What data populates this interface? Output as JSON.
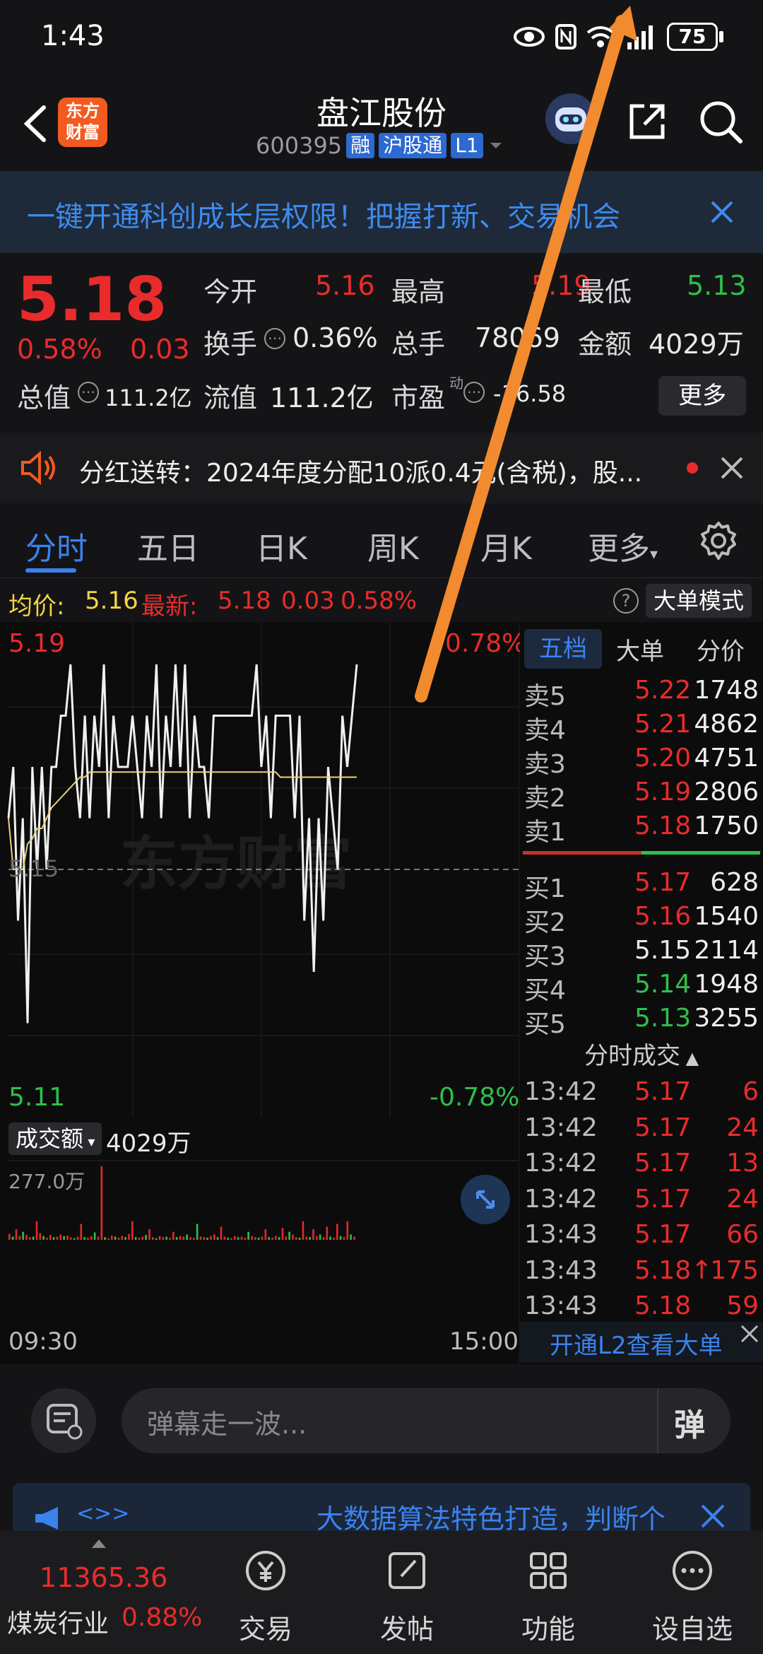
{
  "status": {
    "time": "1:43",
    "battery": "75"
  },
  "header": {
    "logo_text_1": "东方",
    "logo_text_2": "财富",
    "stock_name": "盘江股份",
    "stock_code": "600395",
    "tag_margin": "融",
    "tag_connect": "沪股通",
    "tag_level": "L1"
  },
  "banner": {
    "text": "一键开通科创成长层权限！把握打新、交易机会"
  },
  "quote": {
    "price": "5.18",
    "change_pct": "0.58%",
    "change_abs": "0.03",
    "open_label": "今开",
    "open_value": "5.16",
    "high_label": "最高",
    "high_value": "5.19",
    "low_label": "最低",
    "low_value": "5.13",
    "turnover_label": "换手",
    "turnover_value": "0.36%",
    "volume_label": "总手",
    "volume_value": "78069",
    "amount_label": "金额",
    "amount_value": "4029万",
    "mktcap_label": "总值",
    "mktcap_value": "111.2亿",
    "float_label": "流值",
    "float_value": "111.2亿",
    "pe_label": "市盈",
    "pe_sup": "动",
    "pe_value": "-16.58",
    "more_label": "更多"
  },
  "notice": {
    "text": "分红送转：2024年度分配10派0.4元(含税)，股..."
  },
  "tabs": {
    "intraday": "分时",
    "five_day": "五日",
    "day_k": "日K",
    "week_k": "周K",
    "month_k": "月K",
    "more": "更多"
  },
  "avgrow": {
    "avg_label": "均价:",
    "avg_value": "5.16",
    "latest_label": "最新:",
    "latest_value": "5.18",
    "latest_change": "0.03",
    "latest_pct": "0.58%",
    "bigorder_label": "大单模式"
  },
  "chart": {
    "high_price": "5.19",
    "high_pct": "0.78%",
    "mid_price": "5.15",
    "low_price": "5.11",
    "low_pct": "-0.78%",
    "watermark": "东方财富",
    "volume_label": "成交额",
    "volume_value": "4029万",
    "volume_max": "277.0万",
    "time_start": "09:30",
    "time_end": "15:00"
  },
  "chart_data": {
    "type": "line",
    "title": "",
    "ylim": [
      5.11,
      5.19
    ],
    "series": [
      {
        "values": [
          5.16,
          5.17,
          5.14,
          5.16,
          5.12,
          5.17,
          5.15,
          5.17,
          5.15,
          5.17,
          5.17,
          5.18,
          5.18,
          5.19,
          5.17,
          5.16,
          5.18,
          5.16,
          5.18,
          5.17,
          5.19,
          5.16,
          5.18,
          5.17,
          5.17,
          5.17,
          5.18,
          5.17,
          5.16,
          5.18,
          5.17,
          5.19,
          5.16,
          5.18,
          5.17,
          5.19,
          5.17,
          5.19,
          5.16,
          5.18,
          5.17,
          5.17,
          5.16,
          5.18,
          5.18,
          5.18,
          5.18,
          5.18,
          5.18,
          5.18,
          5.18,
          5.18,
          5.19,
          5.17,
          5.18,
          5.16,
          5.18,
          5.18,
          5.18,
          5.18,
          5.16,
          5.18,
          5.14,
          5.16,
          5.13,
          5.16,
          5.14,
          5.17,
          5.16,
          5.15,
          5.18,
          5.17,
          5.18,
          5.19
        ]
      },
      {
        "values": [
          5.16,
          5.15,
          5.15,
          5.15,
          5.155,
          5.156,
          5.158,
          5.158,
          5.16,
          5.162,
          5.163,
          5.164,
          5.165,
          5.166,
          5.167,
          5.168,
          5.168,
          5.169,
          5.169,
          5.169,
          5.169,
          5.169,
          5.169,
          5.169,
          5.169,
          5.169,
          5.169,
          5.169,
          5.169,
          5.169,
          5.169,
          5.169,
          5.169,
          5.169,
          5.169,
          5.169,
          5.169,
          5.169,
          5.169,
          5.169,
          5.169,
          5.169,
          5.169,
          5.169,
          5.169,
          5.169,
          5.169,
          5.169,
          5.169,
          5.169,
          5.169,
          5.169,
          5.169,
          5.169,
          5.169,
          5.169,
          5.169,
          5.168,
          5.168,
          5.168,
          5.168,
          5.168,
          5.168,
          5.168,
          5.168,
          5.168,
          5.168,
          5.168,
          5.168,
          5.168,
          5.168,
          5.168,
          5.168,
          5.168
        ]
      }
    ],
    "volume": [
      22,
      12,
      40,
      15,
      30,
      18,
      10,
      12,
      70,
      25,
      14,
      8,
      18,
      10,
      12,
      20,
      14,
      16,
      9,
      6,
      12,
      60,
      10,
      8,
      14,
      28,
      12,
      277,
      10,
      6,
      16,
      12,
      8,
      14,
      10,
      22,
      70,
      10,
      8,
      12,
      18,
      40,
      10,
      6,
      14,
      10,
      12,
      8,
      30,
      10,
      14,
      12,
      20,
      10,
      8,
      60,
      12,
      10,
      8,
      14,
      20,
      10,
      50,
      12,
      8,
      6,
      14,
      10,
      12,
      8,
      30,
      14,
      10,
      8,
      12,
      40,
      10,
      8,
      14,
      10,
      45,
      12,
      30,
      20,
      10,
      8,
      70,
      12,
      10,
      40,
      14,
      20,
      10,
      50,
      12,
      8,
      60,
      14,
      10,
      70,
      20,
      12
    ]
  },
  "orderbook": {
    "tab_five": "五档",
    "tab_big": "大单",
    "tab_price": "分价",
    "asks": [
      {
        "label": "卖5",
        "price": "5.22",
        "vol": "1748",
        "color": "#ea2b2b"
      },
      {
        "label": "卖4",
        "price": "5.21",
        "vol": "4862",
        "color": "#ea2b2b"
      },
      {
        "label": "卖3",
        "price": "5.20",
        "vol": "4751",
        "color": "#ea2b2b"
      },
      {
        "label": "卖2",
        "price": "5.19",
        "vol": "2806",
        "color": "#ea2b2b"
      },
      {
        "label": "卖1",
        "price": "5.18",
        "vol": "1750",
        "color": "#ea2b2b"
      }
    ],
    "bids": [
      {
        "label": "买1",
        "price": "5.17",
        "vol": "628",
        "color": "#ea2b2b"
      },
      {
        "label": "买2",
        "price": "5.16",
        "vol": "1540",
        "color": "#ea2b2b"
      },
      {
        "label": "买3",
        "price": "5.15",
        "vol": "2114",
        "color": "#e9e9ea"
      },
      {
        "label": "买4",
        "price": "5.14",
        "vol": "1948",
        "color": "#2fbf4a"
      },
      {
        "label": "买5",
        "price": "5.13",
        "vol": "3255",
        "color": "#2fbf4a"
      }
    ],
    "trades_title": "分时成交",
    "trades": [
      {
        "time": "13:42",
        "price": "5.17",
        "vol": "6"
      },
      {
        "time": "13:42",
        "price": "5.17",
        "vol": "24"
      },
      {
        "time": "13:42",
        "price": "5.17",
        "vol": "13"
      },
      {
        "time": "13:42",
        "price": "5.17",
        "vol": "24"
      },
      {
        "time": "13:43",
        "price": "5.17",
        "vol": "66"
      },
      {
        "time": "13:43",
        "price": "5.18↑",
        "vol": "175"
      },
      {
        "time": "13:43",
        "price": "5.18",
        "vol": "59"
      }
    ],
    "l2_link": "开通L2查看大单"
  },
  "chat": {
    "placeholder": "弹幕走一波...",
    "danmu_button": "弹"
  },
  "promo": {
    "prefix": "<>>",
    "text": "大数据算法特色打造，判断个"
  },
  "bottomnav": {
    "index_value": "11365.36",
    "index_name": "煤炭行业",
    "index_pct": "0.88%",
    "trade": "交易",
    "post": "发帖",
    "features": "功能",
    "watchlist": "设自选"
  }
}
